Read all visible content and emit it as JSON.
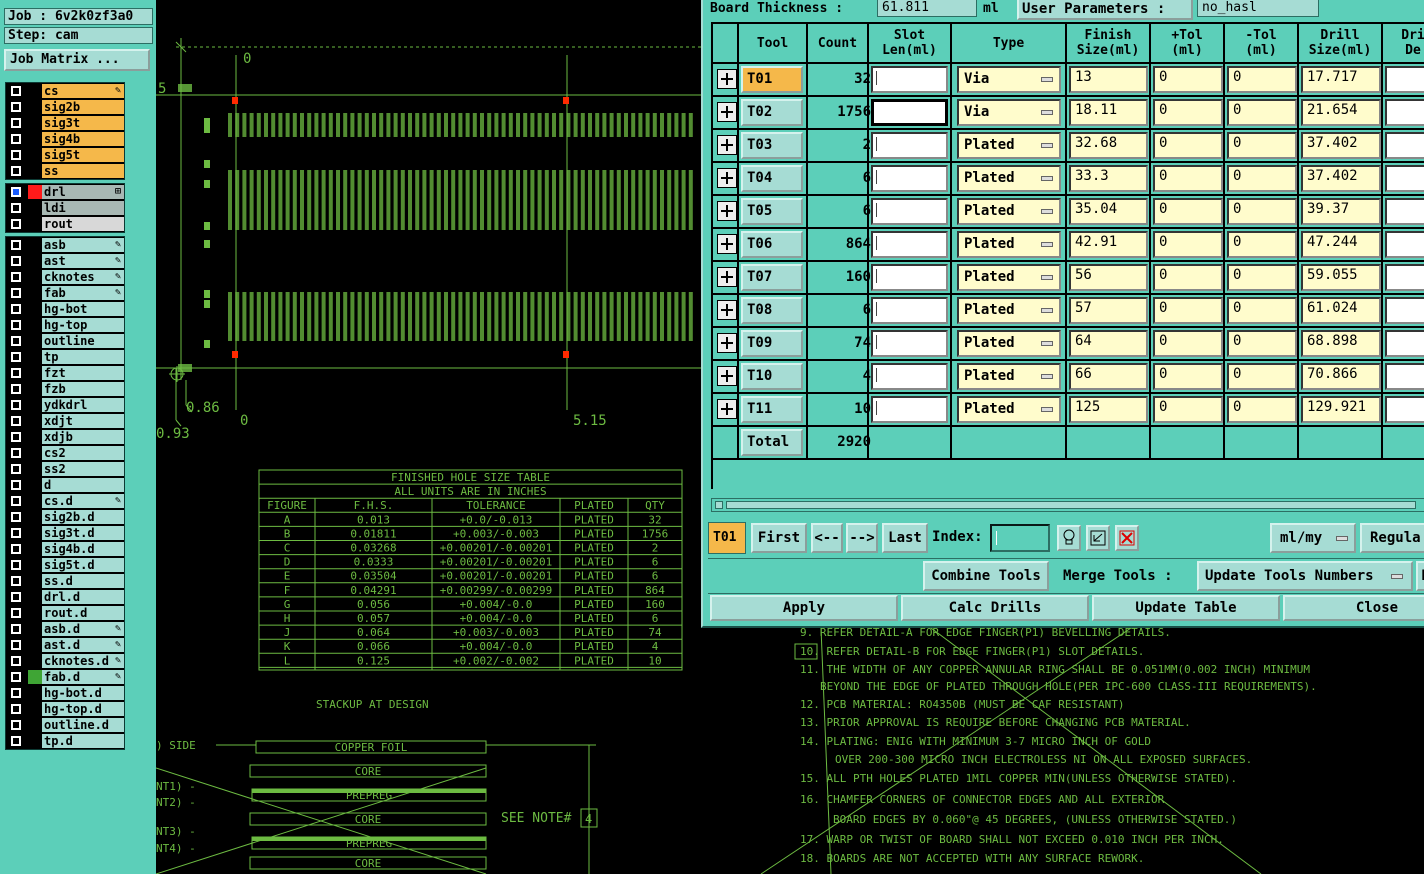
{
  "job": {
    "job_line": "Job : 6v2k0zf3a0",
    "step_line": "Step: cam",
    "matrix_label": "Job Matrix ..."
  },
  "layers": {
    "group1": [
      {
        "name": "cs",
        "color": "#f5b84a",
        "flag": "✎"
      },
      {
        "name": "sig2b",
        "color": "#f5b84a",
        "flag": ""
      },
      {
        "name": "sig3t",
        "color": "#f5b84a",
        "flag": ""
      },
      {
        "name": "sig4b",
        "color": "#f5b84a",
        "flag": ""
      },
      {
        "name": "sig5t",
        "color": "#f5b84a",
        "flag": ""
      },
      {
        "name": "ss",
        "color": "#f5b84a",
        "flag": ""
      }
    ],
    "group2": [
      {
        "name": "drl",
        "color": "#a8b8b4",
        "flag": "⊞"
      },
      {
        "name": "ldi",
        "color": "#a8b8b4",
        "flag": ""
      },
      {
        "name": "rout",
        "color": "#d8d8d8",
        "flag": ""
      }
    ],
    "group3": [
      {
        "name": "asb",
        "flag": "✎"
      },
      {
        "name": "ast",
        "flag": "✎"
      },
      {
        "name": "cknotes",
        "flag": "✎"
      },
      {
        "name": "fab",
        "flag": "✎"
      },
      {
        "name": "hg-bot",
        "flag": ""
      },
      {
        "name": "hg-top",
        "flag": ""
      },
      {
        "name": "outline",
        "flag": ""
      },
      {
        "name": "tp",
        "flag": ""
      },
      {
        "name": "fzt",
        "flag": ""
      },
      {
        "name": "fzb",
        "flag": ""
      },
      {
        "name": "ydkdrl",
        "flag": ""
      },
      {
        "name": "xdjt",
        "flag": ""
      },
      {
        "name": "xdjb",
        "flag": ""
      },
      {
        "name": "cs2",
        "flag": ""
      },
      {
        "name": "ss2",
        "flag": ""
      },
      {
        "name": "d",
        "flag": ""
      },
      {
        "name": "cs.d",
        "flag": "✎"
      },
      {
        "name": "sig2b.d",
        "flag": ""
      },
      {
        "name": "sig3t.d",
        "flag": ""
      },
      {
        "name": "sig4b.d",
        "flag": ""
      },
      {
        "name": "sig5t.d",
        "flag": ""
      },
      {
        "name": "ss.d",
        "flag": ""
      },
      {
        "name": "drl.d",
        "flag": ""
      },
      {
        "name": "rout.d",
        "flag": ""
      },
      {
        "name": "asb.d",
        "flag": "✎"
      },
      {
        "name": "ast.d",
        "flag": "✎"
      },
      {
        "name": "cknotes.d",
        "flag": "✎"
      },
      {
        "name": "fab.d",
        "flag": "✎"
      },
      {
        "name": "hg-bot.d",
        "flag": ""
      },
      {
        "name": "hg-top.d",
        "flag": ""
      },
      {
        "name": "outline.d",
        "flag": ""
      },
      {
        "name": "tp.d",
        "flag": ""
      }
    ]
  },
  "dialog": {
    "board_thickness_label": "Board Thickness :",
    "board_thickness_value": "61.811",
    "board_thickness_unit": "ml",
    "user_params_label": "User Parameters :",
    "user_params_value": "no_hasl",
    "columns": [
      "Tool",
      "Count",
      "Slot\nLen(ml)",
      "Type",
      "Finish\nSize(ml)",
      "+Tol\n(ml)",
      "-Tol\n(ml)",
      "Drill\nSize(ml)",
      "Dri\nDe"
    ],
    "rows": [
      {
        "tool": "T01",
        "count": "32",
        "type": "Via",
        "finish": "13",
        "ptol": "0",
        "ntol": "0",
        "drill": "17.717"
      },
      {
        "tool": "T02",
        "count": "1756",
        "type": "Via",
        "finish": "18.11",
        "ptol": "0",
        "ntol": "0",
        "drill": "21.654"
      },
      {
        "tool": "T03",
        "count": "2",
        "type": "Plated",
        "finish": "32.68",
        "ptol": "0",
        "ntol": "0",
        "drill": "37.402"
      },
      {
        "tool": "T04",
        "count": "6",
        "type": "Plated",
        "finish": "33.3",
        "ptol": "0",
        "ntol": "0",
        "drill": "37.402"
      },
      {
        "tool": "T05",
        "count": "6",
        "type": "Plated",
        "finish": "35.04",
        "ptol": "0",
        "ntol": "0",
        "drill": "39.37"
      },
      {
        "tool": "T06",
        "count": "864",
        "type": "Plated",
        "finish": "42.91",
        "ptol": "0",
        "ntol": "0",
        "drill": "47.244"
      },
      {
        "tool": "T07",
        "count": "160",
        "type": "Plated",
        "finish": "56",
        "ptol": "0",
        "ntol": "0",
        "drill": "59.055"
      },
      {
        "tool": "T08",
        "count": "6",
        "type": "Plated",
        "finish": "57",
        "ptol": "0",
        "ntol": "0",
        "drill": "61.024"
      },
      {
        "tool": "T09",
        "count": "74",
        "type": "Plated",
        "finish": "64",
        "ptol": "0",
        "ntol": "0",
        "drill": "68.898"
      },
      {
        "tool": "T10",
        "count": "4",
        "type": "Plated",
        "finish": "66",
        "ptol": "0",
        "ntol": "0",
        "drill": "70.866"
      },
      {
        "tool": "T11",
        "count": "10",
        "type": "Plated",
        "finish": "125",
        "ptol": "0",
        "ntol": "0",
        "drill": "129.921"
      }
    ],
    "total_label": "Total",
    "total_count": "2920",
    "current_tool": "T01",
    "nav": {
      "first": "First",
      "prev": "<--",
      "next": "-->",
      "last": "Last",
      "index_label": "Index:",
      "units": "ml/my",
      "regular": "Regula"
    },
    "actions": {
      "combine": "Combine Tools",
      "merge": "Merge Tools :",
      "update_numbers": "Update Tools Numbers",
      "apply": "Apply",
      "calc": "Calc Drills",
      "update_table": "Update Table",
      "close": "Close"
    }
  },
  "cad": {
    "dim_top_zero": "0",
    "dim_left_5": "5",
    "dim_086": "0.86",
    "dim_093": "0.93",
    "dim_bottom_zero": "0",
    "dim_515": "5.15",
    "hole_table": {
      "title": "FINISHED HOLE SIZE TABLE",
      "subtitle": "ALL UNITS ARE IN INCHES",
      "headers": [
        "FIGURE",
        "F.H.S.",
        "TOLERANCE",
        "PLATED",
        "QTY"
      ],
      "rows": [
        [
          "A",
          "0.013",
          "+0.0/-0.013",
          "PLATED",
          "32"
        ],
        [
          "B",
          "0.01811",
          "+0.003/-0.003",
          "PLATED",
          "1756"
        ],
        [
          "C",
          "0.03268",
          "+0.00201/-0.00201",
          "PLATED",
          "2"
        ],
        [
          "D",
          "0.0333",
          "+0.00201/-0.00201",
          "PLATED",
          "6"
        ],
        [
          "E",
          "0.03504",
          "+0.00201/-0.00201",
          "PLATED",
          "6"
        ],
        [
          "F",
          "0.04291",
          "+0.00299/-0.00299",
          "PLATED",
          "864"
        ],
        [
          "G",
          "0.056",
          "+0.004/-0.0",
          "PLATED",
          "160"
        ],
        [
          "H",
          "0.057",
          "+0.004/-0.0",
          "PLATED",
          "6"
        ],
        [
          "J",
          "0.064",
          "+0.003/-0.003",
          "PLATED",
          "74"
        ],
        [
          "K",
          "0.066",
          "+0.004/-0.0",
          "PLATED",
          "4"
        ],
        [
          "L",
          "0.125",
          "+0.002/-0.002",
          "PLATED",
          "10"
        ]
      ]
    },
    "stackup_title": "STACKUP AT DESIGN",
    "stackup_side": ") SIDE",
    "stackup_layers": [
      "COPPER FOIL",
      "CORE",
      "PREPREG",
      "CORE",
      "PREPREG",
      "CORE"
    ],
    "stackup_side_labels": [
      "NT1) -",
      "NT2) -",
      "NT3) -",
      "NT4) -"
    ],
    "see_note": "SEE NOTE#",
    "see_note_num": "4",
    "notes": [
      "9. REFER DETAIL-A FOR EDGE FINGER(P1) BEVELLING DETAILS.",
      "10. REFER DETAIL-B FOR EDGE FINGER(P1) SLOT DETAILS.",
      "11. THE WIDTH OF ANY COPPER ANNULAR RING SHALL BE 0.051MM(0.002 INCH) MINIMUM",
      "    BEYOND THE EDGE OF PLATED THROUGH HOLE(PER IPC-600 CLASS-III REQUIREMENTS).",
      "12. PCB MATERIAL: RO4350B (MUST BE CAF RESISTANT)",
      "13. PRIOR APPROVAL IS REQUIRE BEFORE CHANGING PCB MATERIAL.",
      "14. PLATING: ENIG WITH MINIMUM 3-7 MICRO INCH OF GOLD",
      "      OVER 200-300 MICRO INCH ELECTROLESS NI  ON ALL EXPOSED SURFACES.",
      "15. ALL PTH HOLES PLATED 1MIL COPPER MIN(UNLESS OTHERWISE STATED).",
      "16. CHAMFER CORNERS OF CONNECTOR EDGES AND ALL EXTERIOR",
      "      BOARD EDGES BY 0.060\"@ 45 DEGREES, (UNLESS OTHERWISE STATED.)",
      "17. WARP OR TWIST OF BOARD SHALL NOT EXCEED 0.010 INCH PER INCH.",
      "18. BOARDS ARE NOT ACCEPTED WITH ANY SURFACE REWORK."
    ]
  },
  "colors": {
    "panel": "#5ccfb9",
    "button": "#a6dcd4",
    "selected_tool": "#f5b84a",
    "input_yellow": "#fffccc",
    "cad_green": "#6dbb42"
  }
}
